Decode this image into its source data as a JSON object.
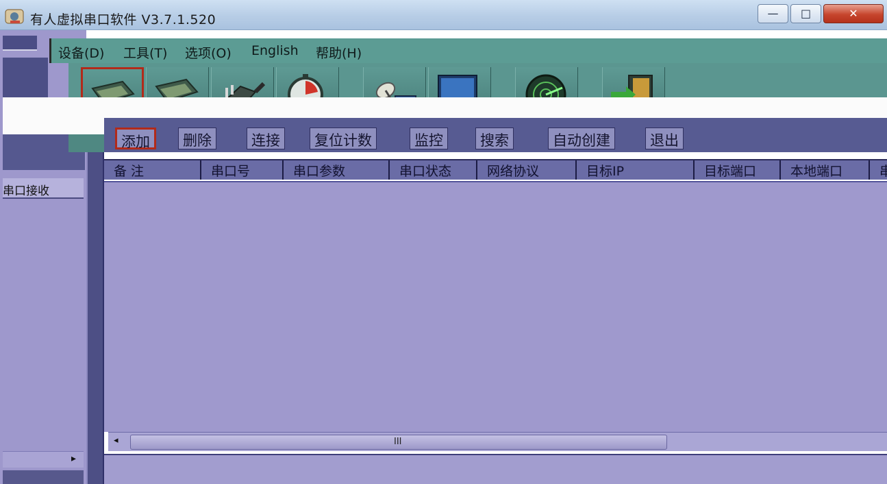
{
  "window": {
    "title": "有人虚拟串口软件 V3.7.1.520",
    "minimize_label": "—",
    "maximize_label": "□",
    "close_label": "✕"
  },
  "menu": {
    "items": [
      {
        "label": "设备(D)"
      },
      {
        "label": "工具(T)"
      },
      {
        "label": "选项(O)"
      },
      {
        "label": "English"
      },
      {
        "label": "帮助(H)"
      }
    ]
  },
  "toolbar": {
    "buttons": [
      {
        "label": "添加",
        "icon": "serial-port-add-icon"
      },
      {
        "label": "删除",
        "icon": "serial-port-delete-icon"
      },
      {
        "label": "连接",
        "icon": "plug-connect-icon"
      },
      {
        "label": "复位计数",
        "icon": "stopwatch-reset-icon"
      },
      {
        "label": "监控",
        "icon": "satellite-monitor-icon"
      },
      {
        "label": "搜索",
        "icon": "computer-search-icon"
      },
      {
        "label": "自动创建",
        "icon": "radar-auto-create-icon"
      },
      {
        "label": "退出",
        "icon": "exit-door-icon"
      }
    ]
  },
  "left_panel": {
    "receive_header": "串口接收"
  },
  "table": {
    "columns": [
      "备 注",
      "串口号",
      "串口参数",
      "串口状态",
      "网络协议",
      "目标IP",
      "目标端口",
      "本地端口",
      "串"
    ],
    "rows": []
  },
  "scrollbar": {
    "grip": "III"
  },
  "colors": {
    "accent_red": "#b22a1a",
    "menubar": "#5c9c94",
    "panel": "#9f99cd"
  }
}
